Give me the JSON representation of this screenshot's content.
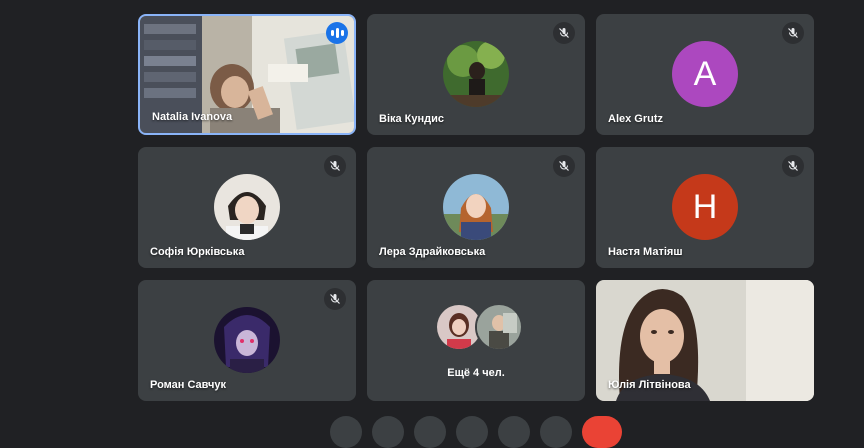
{
  "colors": {
    "background": "#202124",
    "tile": "#3c4043",
    "active_border": "#8ab4f8",
    "speaking": "#1a73e8",
    "avatar_a": "#ac48bf",
    "avatar_h": "#c5391a",
    "end_call": "#ea4335"
  },
  "participants": [
    {
      "name": "Natalia Ivanova",
      "video": true,
      "speaking": true,
      "muted": false
    },
    {
      "name": "Віка Кундис",
      "muted": true,
      "avatar": "photo"
    },
    {
      "name": "Alex Grutz",
      "muted": true,
      "initial": "A"
    },
    {
      "name": "Софія Юрківська",
      "muted": true,
      "avatar": "photo"
    },
    {
      "name": "Лера Здрайковська",
      "muted": true,
      "avatar": "photo"
    },
    {
      "name": "Настя Матіяш",
      "muted": true,
      "initial": "H"
    },
    {
      "name": "Роман Савчук",
      "muted": true,
      "avatar": "photo"
    },
    {
      "name": "Юлія Літвінова",
      "video": true,
      "muted": false
    }
  ],
  "more": {
    "label": "Ещё 4 чел."
  },
  "icons": {
    "mute": "mic-off-icon",
    "speaking": "audio-level-icon"
  }
}
